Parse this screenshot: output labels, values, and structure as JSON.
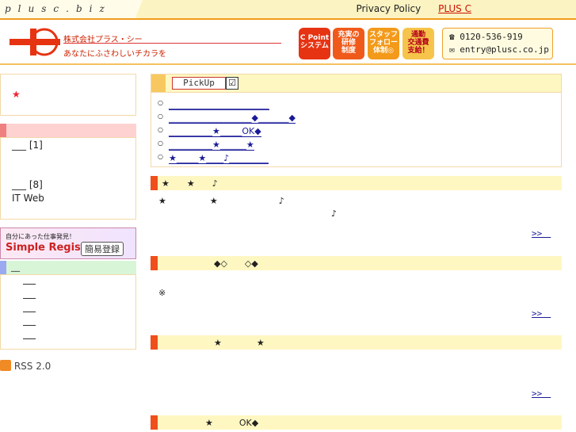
{
  "topbar": {
    "site": "plusc.biz",
    "privacy": "Privacy Policy",
    "plusc": "PLUS C"
  },
  "header": {
    "company": "株式会社プラス・シー",
    "tagline": "あなたにふさわしいチカラを",
    "badges": [
      {
        "l1": "C Point",
        "l2": "システム",
        "l3": ""
      },
      {
        "l1": "充実の",
        "l2": "研修",
        "l3": "制度"
      },
      {
        "l1": "スタッフ",
        "l2": "フォロー",
        "l3": "体制◎"
      },
      {
        "l1": "通勤",
        "l2": "交通費",
        "l3": "支給！"
      }
    ],
    "phone": "0120-536-919",
    "email": "entry@plusc.co.jp"
  },
  "sidebar": {
    "star": "★",
    "cat1": "___ [1]",
    "cat2": "___ [8]",
    "cat3": "IT Web",
    "banner": {
      "t1": "自分にあった仕事発見！",
      "t2": "Simple Regist",
      "t3": "簡易登録"
    },
    "list_head": "__",
    "rss": "RSS 2.0"
  },
  "pickup": {
    "label": "PickUp",
    "check": "☑",
    "items": [
      "_______________________",
      "___________________◆_______◆",
      "__________★_____OK◆",
      "__________★______★",
      "★_____★____♪_________"
    ]
  },
  "sections": [
    {
      "title": "★　　★　　♪",
      "line1": "★　　　　　★　　　　　　　♪",
      "line2": "♪",
      "more": ">>　"
    },
    {
      "title": "　　　　　　◆◇　　◇◆",
      "line1": "※",
      "line2": "",
      "more": ">>　"
    },
    {
      "title": "　　　　　　★　　　　★",
      "line1": "",
      "line2": "",
      "more": ">>　"
    },
    {
      "title": "　　　　　★　　　OK◆",
      "line1": "",
      "line2": "",
      "more": ""
    }
  ],
  "colors": {
    "accent": "#f04e1a",
    "brand_red": "#e63312",
    "head_bg": "#fff7c2"
  }
}
